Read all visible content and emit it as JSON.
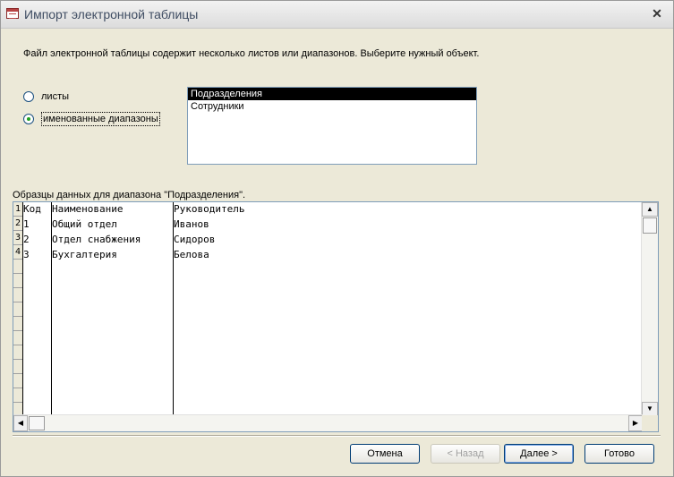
{
  "window": {
    "title": "Импорт электронной таблицы",
    "close_symbol": "✕"
  },
  "instruction": "Файл электронной таблицы содержит несколько листов или диапазонов.  Выберите нужный объект.",
  "options": {
    "sheets_label": "листы",
    "named_ranges_label": "именованные диапазоны",
    "selected": "named_ranges"
  },
  "list": {
    "items": [
      "Подразделения",
      "Сотрудники"
    ],
    "selected_index": 0
  },
  "preview": {
    "caption": "Образцы данных для диапазона \"Подразделения\".",
    "row_numbers": [
      "1",
      "2",
      "3",
      "4"
    ],
    "rows": [
      [
        "Код",
        "Наименование",
        "Руководитель"
      ],
      [
        "1",
        "Общий отдел",
        "Иванов"
      ],
      [
        "2",
        "Отдел снабжения",
        "Сидоров"
      ],
      [
        "3",
        "Бухгалтерия",
        "Белова"
      ]
    ]
  },
  "buttons": {
    "cancel": "Отмена",
    "back": "< Назад",
    "next": "Далее >",
    "finish": "Готово"
  },
  "icons": {
    "app": "table-import-icon",
    "scroll_up": "▲",
    "scroll_down": "▼",
    "scroll_left": "◀",
    "scroll_right": "▶"
  }
}
